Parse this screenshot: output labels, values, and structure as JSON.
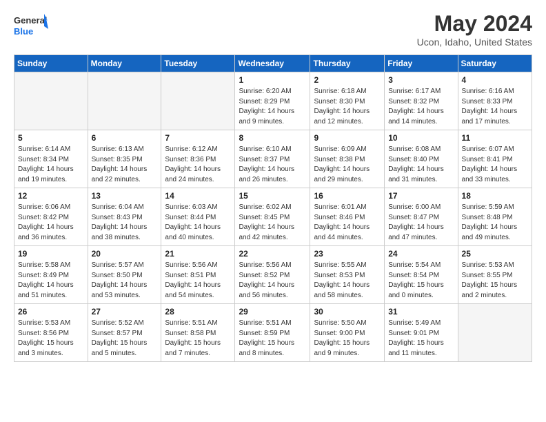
{
  "header": {
    "logo_line1": "General",
    "logo_line2": "Blue",
    "month": "May 2024",
    "location": "Ucon, Idaho, United States"
  },
  "weekdays": [
    "Sunday",
    "Monday",
    "Tuesday",
    "Wednesday",
    "Thursday",
    "Friday",
    "Saturday"
  ],
  "weeks": [
    [
      {
        "day": "",
        "empty": true
      },
      {
        "day": "",
        "empty": true
      },
      {
        "day": "",
        "empty": true
      },
      {
        "day": "1",
        "sunrise": "6:20 AM",
        "sunset": "8:29 PM",
        "daylight": "14 hours and 9 minutes."
      },
      {
        "day": "2",
        "sunrise": "6:18 AM",
        "sunset": "8:30 PM",
        "daylight": "14 hours and 12 minutes."
      },
      {
        "day": "3",
        "sunrise": "6:17 AM",
        "sunset": "8:32 PM",
        "daylight": "14 hours and 14 minutes."
      },
      {
        "day": "4",
        "sunrise": "6:16 AM",
        "sunset": "8:33 PM",
        "daylight": "14 hours and 17 minutes."
      }
    ],
    [
      {
        "day": "5",
        "sunrise": "6:14 AM",
        "sunset": "8:34 PM",
        "daylight": "14 hours and 19 minutes."
      },
      {
        "day": "6",
        "sunrise": "6:13 AM",
        "sunset": "8:35 PM",
        "daylight": "14 hours and 22 minutes."
      },
      {
        "day": "7",
        "sunrise": "6:12 AM",
        "sunset": "8:36 PM",
        "daylight": "14 hours and 24 minutes."
      },
      {
        "day": "8",
        "sunrise": "6:10 AM",
        "sunset": "8:37 PM",
        "daylight": "14 hours and 26 minutes."
      },
      {
        "day": "9",
        "sunrise": "6:09 AM",
        "sunset": "8:38 PM",
        "daylight": "14 hours and 29 minutes."
      },
      {
        "day": "10",
        "sunrise": "6:08 AM",
        "sunset": "8:40 PM",
        "daylight": "14 hours and 31 minutes."
      },
      {
        "day": "11",
        "sunrise": "6:07 AM",
        "sunset": "8:41 PM",
        "daylight": "14 hours and 33 minutes."
      }
    ],
    [
      {
        "day": "12",
        "sunrise": "6:06 AM",
        "sunset": "8:42 PM",
        "daylight": "14 hours and 36 minutes."
      },
      {
        "day": "13",
        "sunrise": "6:04 AM",
        "sunset": "8:43 PM",
        "daylight": "14 hours and 38 minutes."
      },
      {
        "day": "14",
        "sunrise": "6:03 AM",
        "sunset": "8:44 PM",
        "daylight": "14 hours and 40 minutes."
      },
      {
        "day": "15",
        "sunrise": "6:02 AM",
        "sunset": "8:45 PM",
        "daylight": "14 hours and 42 minutes."
      },
      {
        "day": "16",
        "sunrise": "6:01 AM",
        "sunset": "8:46 PM",
        "daylight": "14 hours and 44 minutes."
      },
      {
        "day": "17",
        "sunrise": "6:00 AM",
        "sunset": "8:47 PM",
        "daylight": "14 hours and 47 minutes."
      },
      {
        "day": "18",
        "sunrise": "5:59 AM",
        "sunset": "8:48 PM",
        "daylight": "14 hours and 49 minutes."
      }
    ],
    [
      {
        "day": "19",
        "sunrise": "5:58 AM",
        "sunset": "8:49 PM",
        "daylight": "14 hours and 51 minutes."
      },
      {
        "day": "20",
        "sunrise": "5:57 AM",
        "sunset": "8:50 PM",
        "daylight": "14 hours and 53 minutes."
      },
      {
        "day": "21",
        "sunrise": "5:56 AM",
        "sunset": "8:51 PM",
        "daylight": "14 hours and 54 minutes."
      },
      {
        "day": "22",
        "sunrise": "5:56 AM",
        "sunset": "8:52 PM",
        "daylight": "14 hours and 56 minutes."
      },
      {
        "day": "23",
        "sunrise": "5:55 AM",
        "sunset": "8:53 PM",
        "daylight": "14 hours and 58 minutes."
      },
      {
        "day": "24",
        "sunrise": "5:54 AM",
        "sunset": "8:54 PM",
        "daylight": "15 hours and 0 minutes."
      },
      {
        "day": "25",
        "sunrise": "5:53 AM",
        "sunset": "8:55 PM",
        "daylight": "15 hours and 2 minutes."
      }
    ],
    [
      {
        "day": "26",
        "sunrise": "5:53 AM",
        "sunset": "8:56 PM",
        "daylight": "15 hours and 3 minutes."
      },
      {
        "day": "27",
        "sunrise": "5:52 AM",
        "sunset": "8:57 PM",
        "daylight": "15 hours and 5 minutes."
      },
      {
        "day": "28",
        "sunrise": "5:51 AM",
        "sunset": "8:58 PM",
        "daylight": "15 hours and 7 minutes."
      },
      {
        "day": "29",
        "sunrise": "5:51 AM",
        "sunset": "8:59 PM",
        "daylight": "15 hours and 8 minutes."
      },
      {
        "day": "30",
        "sunrise": "5:50 AM",
        "sunset": "9:00 PM",
        "daylight": "15 hours and 9 minutes."
      },
      {
        "day": "31",
        "sunrise": "5:49 AM",
        "sunset": "9:01 PM",
        "daylight": "15 hours and 11 minutes."
      },
      {
        "day": "",
        "empty": true
      }
    ]
  ]
}
